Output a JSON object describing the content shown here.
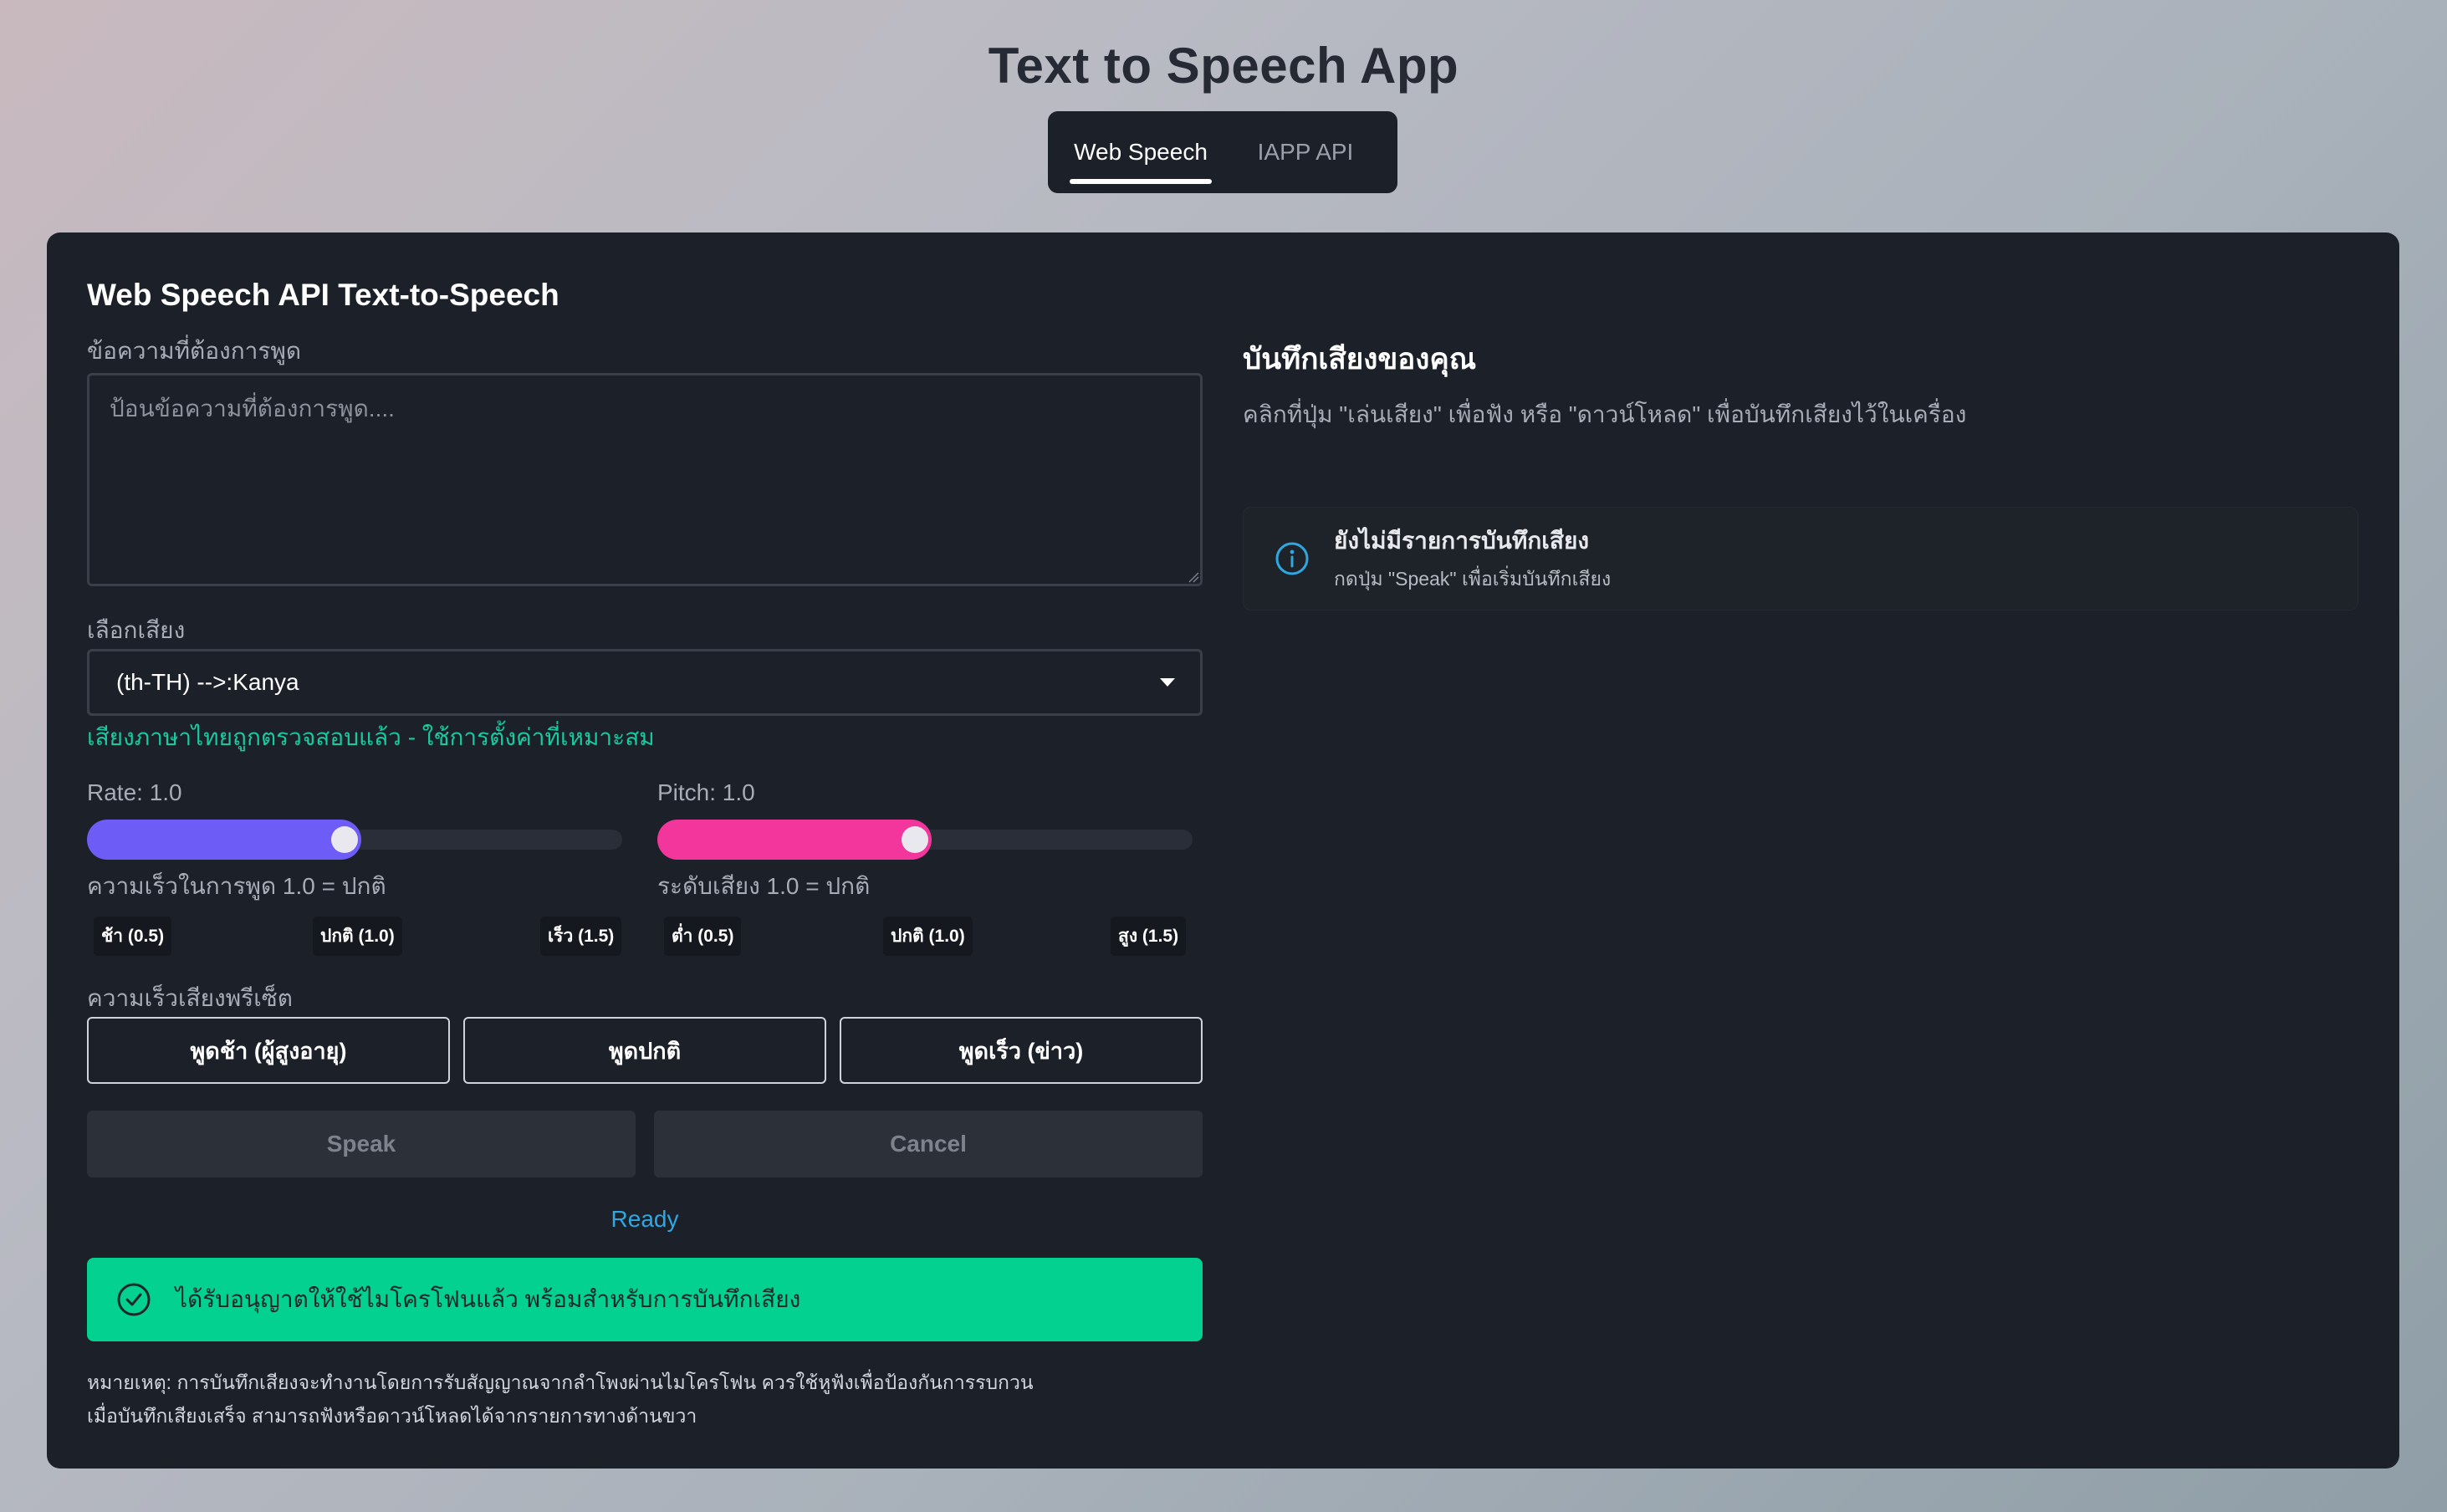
{
  "app": {
    "title": "Text to Speech App"
  },
  "tabs": [
    {
      "label": "Web Speech",
      "active": true
    },
    {
      "label": "IAPP API",
      "active": false
    }
  ],
  "form": {
    "title": "Web Speech API Text-to-Speech",
    "text_label": "ข้อความที่ต้องการพูด",
    "text_placeholder": "ป้อนข้อความที่ต้องการพูด....",
    "text_value": "",
    "voice_label": "เลือกเสียง",
    "voice_selected": "(th-TH) -->:Kanya",
    "voice_status": "เสียงภาษาไทยถูกตรวจสอบแล้ว - ใช้การตั้งค่าที่เหมาะสม"
  },
  "rate": {
    "label": "Rate: 1.0",
    "value": 1.0,
    "min": 0.5,
    "max": 1.5,
    "hint": "ความเร็วในการพูด  1.0 = ปกติ",
    "ticks": [
      "ช้า (0.5)",
      "ปกติ (1.0)",
      "เร็ว (1.5)"
    ],
    "color": "#6e5cf6"
  },
  "pitch": {
    "label": "Pitch: 1.0",
    "value": 1.0,
    "min": 0.5,
    "max": 1.5,
    "hint": "ระดับเสียง  1.0 = ปกติ",
    "ticks": [
      "ต่ำ (0.5)",
      "ปกติ (1.0)",
      "สูง (1.5)"
    ],
    "color": "#f2369b"
  },
  "presets": {
    "label": "ความเร็วเสียงพรีเซ็ต",
    "buttons": [
      "พูดช้า (ผู้สูงอายุ)",
      "พูดปกติ",
      "พูดเร็ว (ข่าว)"
    ]
  },
  "actions": {
    "speak": "Speak",
    "cancel": "Cancel"
  },
  "status": "Ready",
  "mic_notice": "ได้รับอนุญาตให้ใช้ไมโครโฟนแล้ว พร้อมสำหรับการบันทึกเสียง",
  "notes": [
    "หมายเหตุ: การบันทึกเสียงจะทำงานโดยการรับสัญญาณจากลำโพงผ่านไมโครโฟน ควรใช้หูฟังเพื่อป้องกันการรบกวน",
    "เมื่อบันทึกเสียงเสร็จ สามารถฟังหรือดาวน์โหลดได้จากรายการทางด้านขวา"
  ],
  "recordings": {
    "title": "บันทึกเสียงของคุณ",
    "description": "คลิกที่ปุ่ม \"เล่นเสียง\" เพื่อฟัง หรือ \"ดาวน์โหลด\" เพื่อบันทึกเสียงไว้ในเครื่อง",
    "empty_title": "ยังไม่มีรายการบันทึกเสียง",
    "empty_subtitle": "กดปุ่ม \"Speak\" เพื่อเริ่มบันทึกเสียง"
  },
  "icons": {
    "info": "info-circle-icon",
    "success": "check-circle-icon",
    "caret": "chevron-down-icon"
  },
  "colors": {
    "accent_success": "#03d18f",
    "status_text": "#2fa7e0",
    "voice_ok": "#19c9a0",
    "info_icon": "#2fa7e0"
  }
}
